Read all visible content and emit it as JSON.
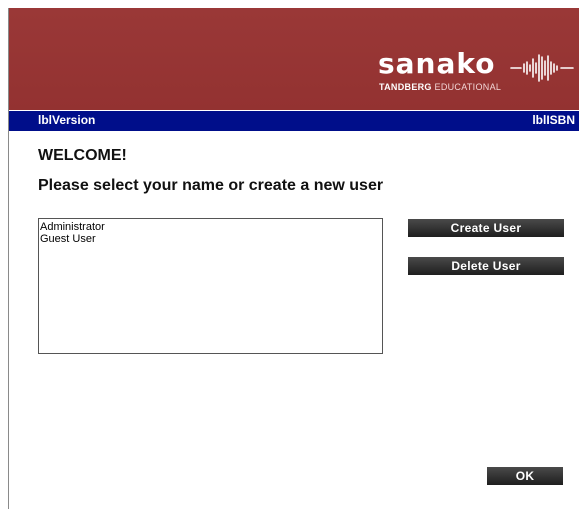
{
  "banner": {
    "logo_word": "sanako",
    "logo_sub_bold": "TANDBERG",
    "logo_sub_rest": " EDUCATIONAL",
    "logo_wave": "sound-wave-icon",
    "brand_color": "#973534"
  },
  "infobar": {
    "version_label": "lblVersion",
    "isbn_label": "lblISBN",
    "color": "#000e8a"
  },
  "main": {
    "welcome": "WELCOME!",
    "prompt": "Please select your name or create a new user",
    "users": [
      "Administrator",
      "Guest User"
    ]
  },
  "buttons": {
    "create": "Create User",
    "delete": "Delete User",
    "ok": "OK"
  }
}
